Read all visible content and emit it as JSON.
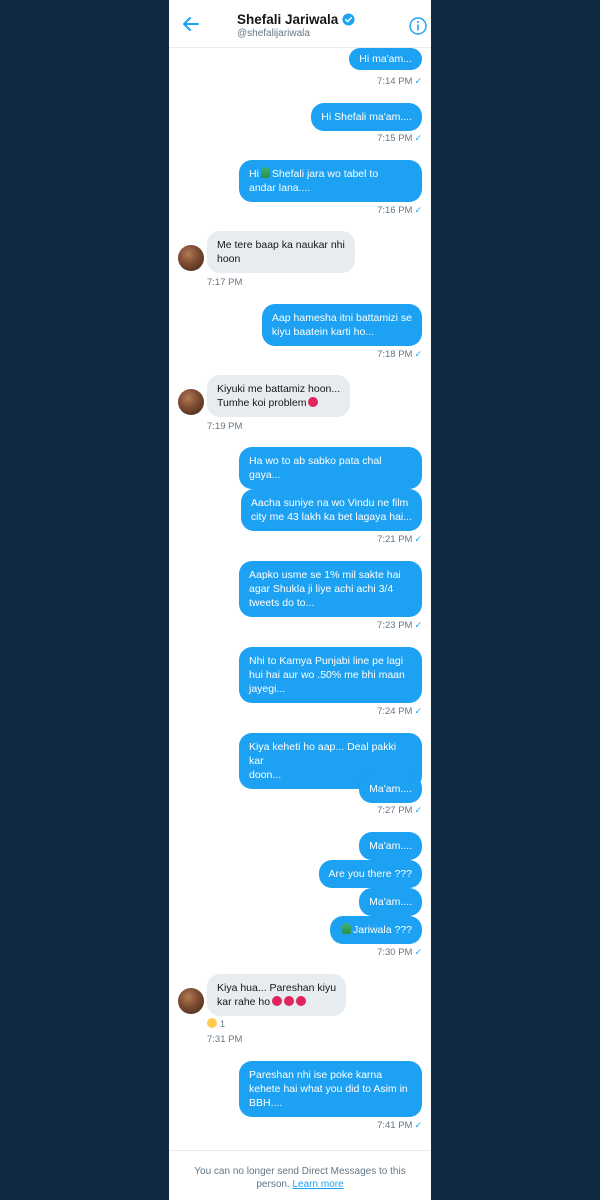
{
  "header": {
    "name": "Shefali Jariwala",
    "handle": "@shefalijariwala",
    "accent": "#1da1f2"
  },
  "messages": [
    {
      "text": "Hi ma'am...",
      "time": "7:14 PM"
    },
    {
      "text": "Hi Shefali ma'am....",
      "time": "7:15 PM"
    },
    {
      "line1a": "Hi",
      "line1b": "Shefali jara wo tabel to",
      "line2": "andar lana....",
      "time": "7:16 PM"
    },
    {
      "line1": "Me tere baap ka naukar nhi",
      "line2": "hoon",
      "time": "7:17 PM"
    },
    {
      "line1": "Aap hamesha itni battamizi se",
      "line2": "kiyu baatein karti ho...",
      "time": "7:18 PM"
    },
    {
      "line1": "Kiyuki me battamiz hoon...",
      "line2": "Tumhe koi problem",
      "time": "7:19 PM"
    },
    {
      "line1": "Ha wo to ab sabko pata chal",
      "line2": "gaya..."
    },
    {
      "line1": "Aacha suniye na wo Vindu ne film",
      "line2": "city me 43 lakh ka bet lagaya hai...",
      "time": "7:21 PM"
    },
    {
      "line1": "Aapko usme se 1% mil sakte hai",
      "line2": "agar Shukla ji liye achi achi 3/4",
      "line3": "tweets do to...",
      "time": "7:23 PM"
    },
    {
      "line1": "Nhi to Kamya Punjabi line pe lagi",
      "line2": "hui hai aur wo .50% me bhi maan",
      "line3": "jayegi...",
      "time": "7:24 PM"
    },
    {
      "line1": "Kiya keheti ho aap... Deal pakki kar",
      "line2": "doon..."
    },
    {
      "text": "Ma'am....",
      "time": "7:27 PM"
    },
    {
      "text": "Ma'am...."
    },
    {
      "text": "Are you there ???"
    },
    {
      "text": "Ma'am...."
    },
    {
      "text": "Jariwala ???",
      "time": "7:30 PM"
    },
    {
      "line1": "Kiya hua... Pareshan kiyu",
      "line2": "kar rahe ho",
      "reaction_count": "1",
      "time": "7:31 PM"
    },
    {
      "line1": "Pareshan nhi ise poke karna",
      "line2": "kehete hai what you did to Asim in",
      "line3": "BBH....",
      "time": "7:41 PM"
    }
  ],
  "footer": {
    "text1": "You can no longer send Direct Messages to this",
    "text2": "person.",
    "link": "Learn more"
  }
}
